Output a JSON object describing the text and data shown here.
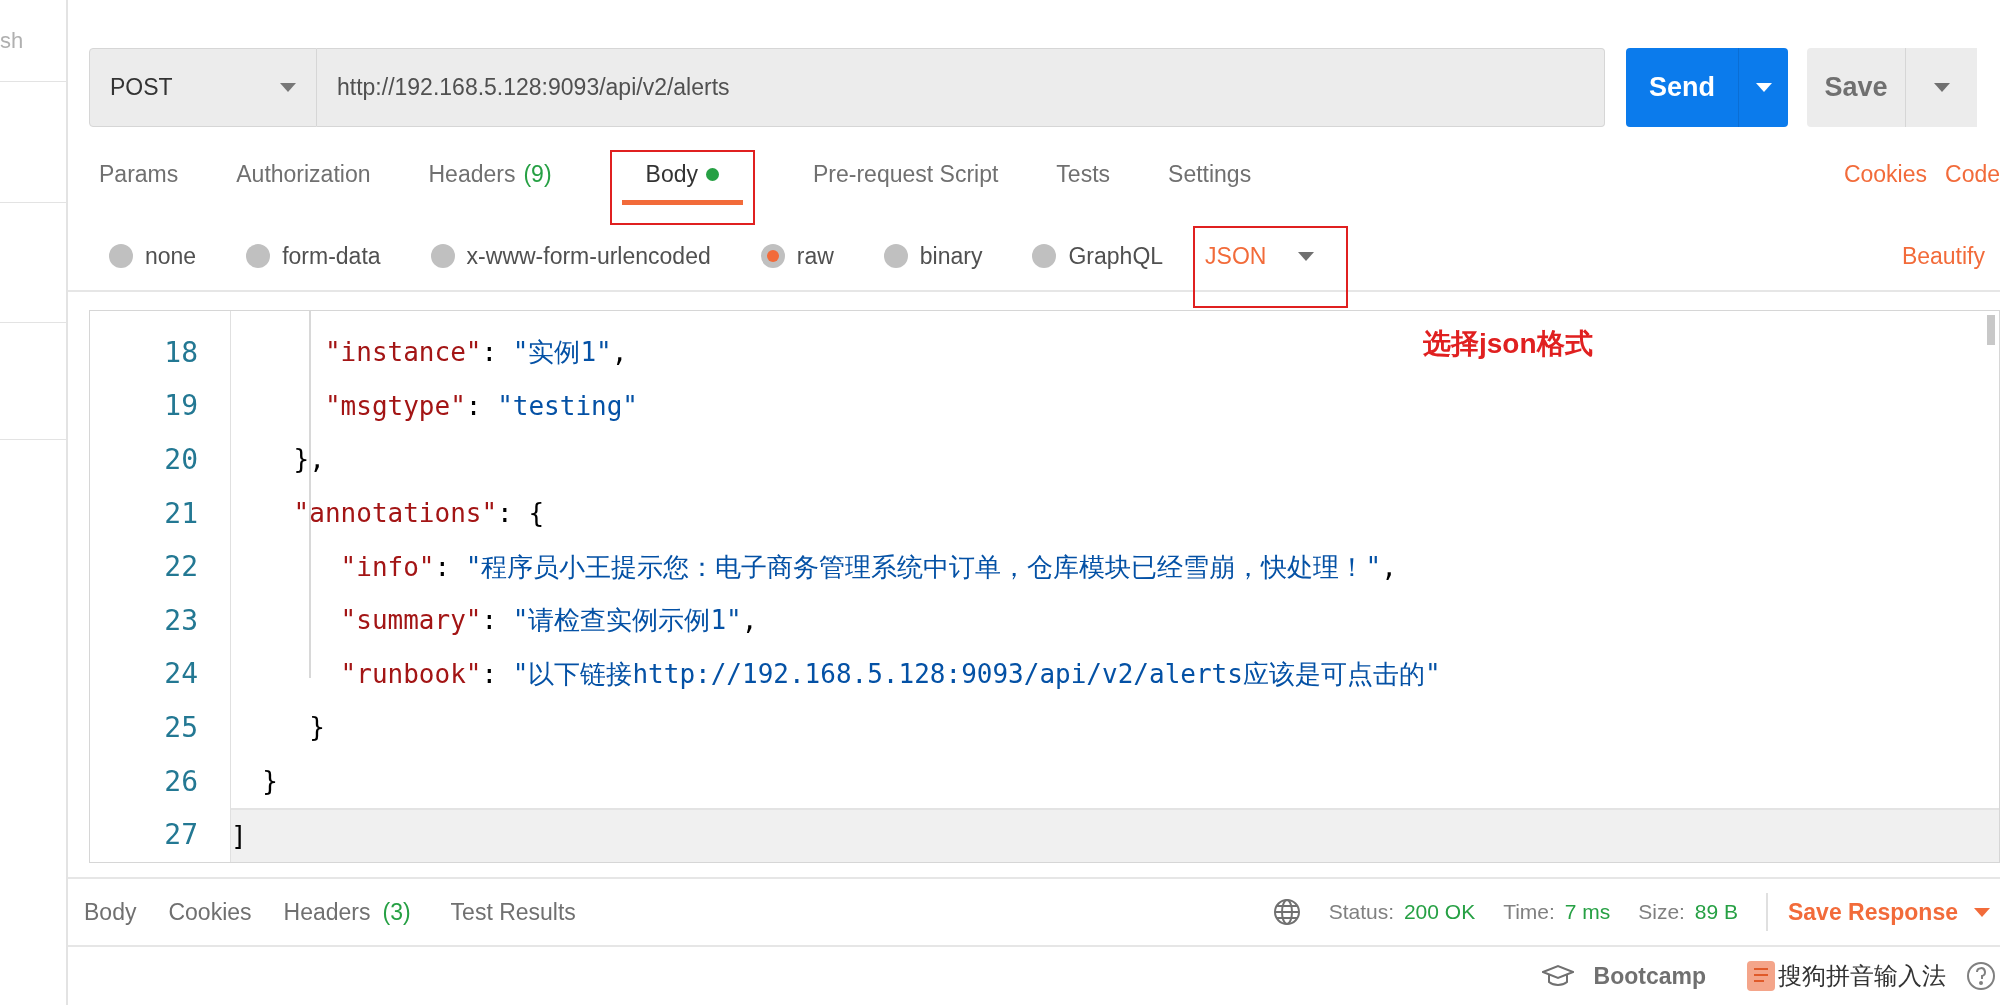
{
  "sidebar": {
    "label": "sh"
  },
  "request": {
    "method": "POST",
    "url": "http://192.168.5.128:9093/api/v2/alerts",
    "send": "Send",
    "save": "Save"
  },
  "tabs": [
    {
      "label": "Params",
      "dot": false,
      "selected": false
    },
    {
      "label": "Authorization",
      "dot": false,
      "selected": false
    },
    {
      "label": "Headers",
      "count": "(9)",
      "dot": false,
      "selected": false
    },
    {
      "label": "Body",
      "dot": true,
      "selected": true
    },
    {
      "label": "Pre-request Script",
      "dot": false,
      "selected": false
    },
    {
      "label": "Tests",
      "dot": false,
      "selected": false
    },
    {
      "label": "Settings",
      "dot": false,
      "selected": false
    }
  ],
  "tab_links": [
    "Cookies",
    "Code"
  ],
  "body_types": [
    {
      "label": "none",
      "selected": false
    },
    {
      "label": "form-data",
      "selected": false
    },
    {
      "label": "x-www-form-urlencoded",
      "selected": false
    },
    {
      "label": "raw",
      "selected": true
    },
    {
      "label": "binary",
      "selected": false
    },
    {
      "label": "GraphQL",
      "selected": false
    }
  ],
  "format": "JSON",
  "beautify": "Beautify",
  "annotation": "选择json格式",
  "editor": {
    "lines": [
      {
        "number": "18",
        "tokens": [
          {
            "kind": "key",
            "text": "      \"instance\""
          },
          {
            "kind": "punct",
            "text": ": "
          },
          {
            "kind": "string",
            "text": "\"实例1\""
          },
          {
            "kind": "punct",
            "text": ","
          }
        ],
        "current": false
      },
      {
        "number": "19",
        "tokens": [
          {
            "kind": "key",
            "text": "      \"msgtype\""
          },
          {
            "kind": "punct",
            "text": ": "
          },
          {
            "kind": "string",
            "text": "\"testing\""
          }
        ],
        "current": false
      },
      {
        "number": "20",
        "tokens": [
          {
            "kind": "punct",
            "text": "    },"
          }
        ],
        "current": false
      },
      {
        "number": "21",
        "tokens": [
          {
            "kind": "key",
            "text": "    \"annotations\""
          },
          {
            "kind": "punct",
            "text": ": {"
          }
        ],
        "current": false
      },
      {
        "number": "22",
        "tokens": [
          {
            "kind": "key",
            "text": "       \"info\""
          },
          {
            "kind": "punct",
            "text": ": "
          },
          {
            "kind": "string",
            "text": "\"程序员小王提示您：电子商务管理系统中订单，仓库模块已经雪崩，快处理！\""
          },
          {
            "kind": "punct",
            "text": ","
          }
        ],
        "current": false
      },
      {
        "number": "23",
        "tokens": [
          {
            "kind": "key",
            "text": "       \"summary\""
          },
          {
            "kind": "punct",
            "text": ": "
          },
          {
            "kind": "string",
            "text": "\"请检查实例示例1\""
          },
          {
            "kind": "punct",
            "text": ","
          }
        ],
        "current": false
      },
      {
        "number": "24",
        "tokens": [
          {
            "kind": "key",
            "text": "       \"runbook\""
          },
          {
            "kind": "punct",
            "text": ": "
          },
          {
            "kind": "string",
            "text": "\"以下链接http://192.168.5.128:9093/api/v2/alerts应该是可点击的\""
          }
        ],
        "current": false
      },
      {
        "number": "25",
        "tokens": [
          {
            "kind": "punct",
            "text": "     }"
          }
        ],
        "current": false
      },
      {
        "number": "26",
        "tokens": [
          {
            "kind": "punct",
            "text": "  }"
          }
        ],
        "current": false
      },
      {
        "number": "27",
        "tokens": [
          {
            "kind": "punct",
            "text": "]"
          }
        ],
        "current": true
      }
    ]
  },
  "response": {
    "tabs": [
      {
        "label": "Body"
      },
      {
        "label": "Cookies"
      },
      {
        "label": "Headers",
        "count": "(3)"
      },
      {
        "label": "Test Results"
      }
    ],
    "stats": [
      {
        "label": "Status:",
        "value": "200 OK"
      },
      {
        "label": "Time:",
        "value": "7 ms"
      },
      {
        "label": "Size:",
        "value": "89 B"
      }
    ],
    "save": "Save Response"
  },
  "footer": {
    "bootcamp": "Bootcamp",
    "ime": "搜狗拼音输入法"
  }
}
